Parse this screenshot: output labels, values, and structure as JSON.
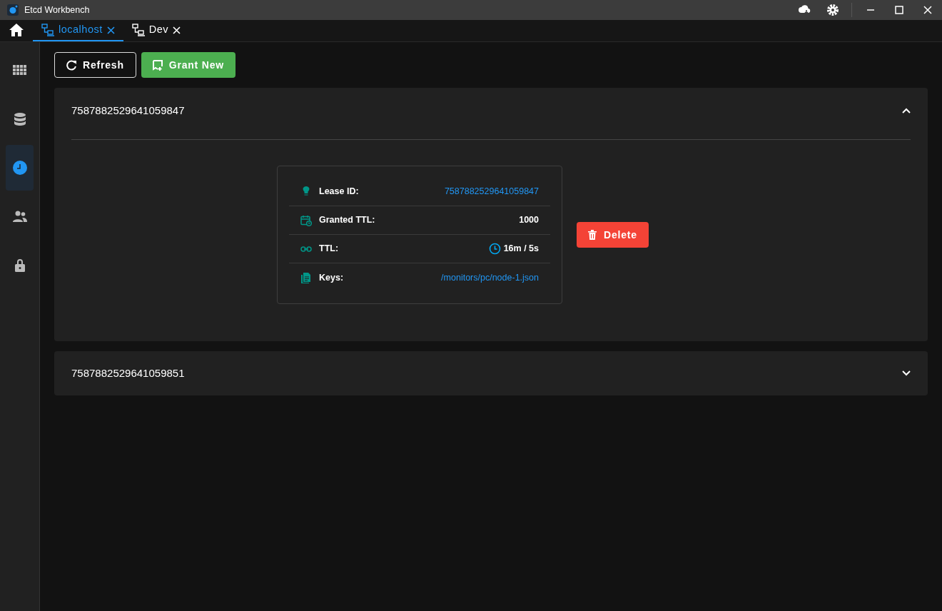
{
  "window": {
    "title": "Etcd Workbench"
  },
  "tabs": [
    {
      "kind": "home",
      "selected": false
    },
    {
      "kind": "connection",
      "label": "localhost",
      "selected": true
    },
    {
      "kind": "connection",
      "label": "Dev",
      "selected": false
    }
  ],
  "sidebar": {
    "items": [
      {
        "selected": false
      },
      {
        "selected": false
      },
      {
        "selected": true
      },
      {
        "selected": false
      },
      {
        "selected": false
      }
    ]
  },
  "toolbar": {
    "buttons": [
      {
        "kind": "outline",
        "label": "Refresh"
      },
      {
        "kind": "success",
        "label": "Grant New"
      }
    ]
  },
  "leases": [
    {
      "title": "7587882529641059847",
      "expanded": true,
      "details": [
        {
          "kind": "link",
          "label": "Lease ID:",
          "value": "7587882529641059847"
        },
        {
          "kind": "text",
          "label": "Granted TTL:",
          "value": "1000"
        },
        {
          "kind": "timer",
          "label": "TTL:",
          "value": "16m / 5s"
        },
        {
          "kind": "link",
          "label": "Keys:",
          "value": "/monitors/pc/node-1.json"
        }
      ],
      "action": "Delete"
    },
    {
      "title": "7587882529641059851",
      "expanded": false
    }
  ]
}
